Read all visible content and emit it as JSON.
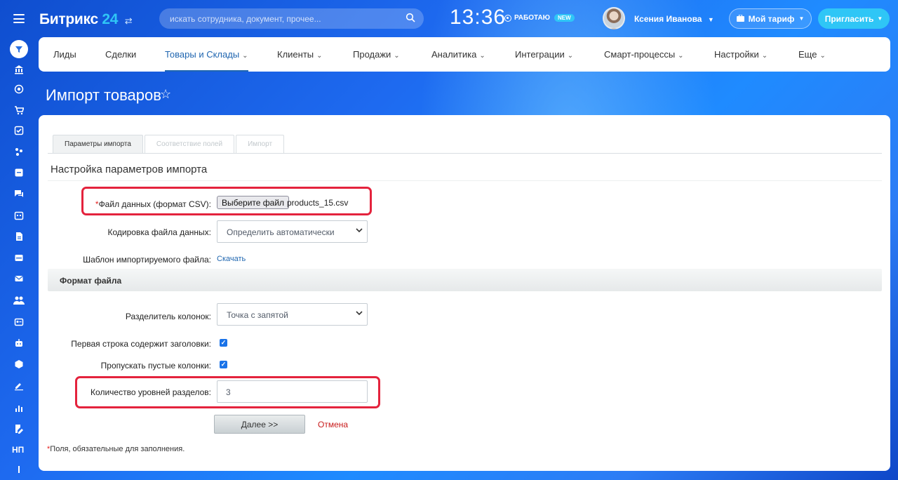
{
  "header": {
    "logo_text": "Битрикс",
    "logo_num": "24",
    "search_placeholder": "искать сотрудника, документ, прочее...",
    "time": "13:36",
    "work_status": "РАБОТАЮ",
    "new_badge": "NEW",
    "user_name": "Ксения Иванова",
    "tariff_label": "Мой тариф",
    "invite_label": "Пригласить"
  },
  "sidebar": {
    "bottom_label": "НП"
  },
  "nav": {
    "items": [
      {
        "label": "Лиды"
      },
      {
        "label": "Сделки"
      },
      {
        "label": "Товары и Склады"
      },
      {
        "label": "Клиенты"
      },
      {
        "label": "Продажи"
      },
      {
        "label": "Аналитика"
      },
      {
        "label": "Интеграции"
      },
      {
        "label": "Смарт-процессы"
      },
      {
        "label": "Настройки"
      },
      {
        "label": "Еще"
      }
    ]
  },
  "page": {
    "title": "Импорт товаров"
  },
  "tabs": [
    {
      "label": "Параметры импорта"
    },
    {
      "label": "Соответствие полей"
    },
    {
      "label": "Импорт"
    }
  ],
  "form": {
    "section_title": "Настройка параметров импорта",
    "file_label_req": "*",
    "file_label": "Файл данных (формат CSV):",
    "file_button": "Выберите файл",
    "file_name": "products_15.csv",
    "encoding_label": "Кодировка файла данных:",
    "encoding_value": "Определить автоматически",
    "template_label": "Шаблон импортируемого файла:",
    "template_link": "Скачать",
    "format_section": "Формат файла",
    "separator_label": "Разделитель колонок:",
    "separator_value": "Точка с запятой",
    "first_row_label": "Первая строка содержит заголовки:",
    "skip_empty_label": "Пропускать пустые колонки:",
    "levels_label": "Количество уровней разделов:",
    "levels_value": "3",
    "next_button": "Далее >>",
    "cancel_link": "Отмена",
    "footnote_req": "*",
    "footnote": "Поля, обязательные для заполнения."
  },
  "colors": {
    "accent": "#2fc6f6",
    "link": "#2067b0",
    "highlight": "#e4233d"
  }
}
